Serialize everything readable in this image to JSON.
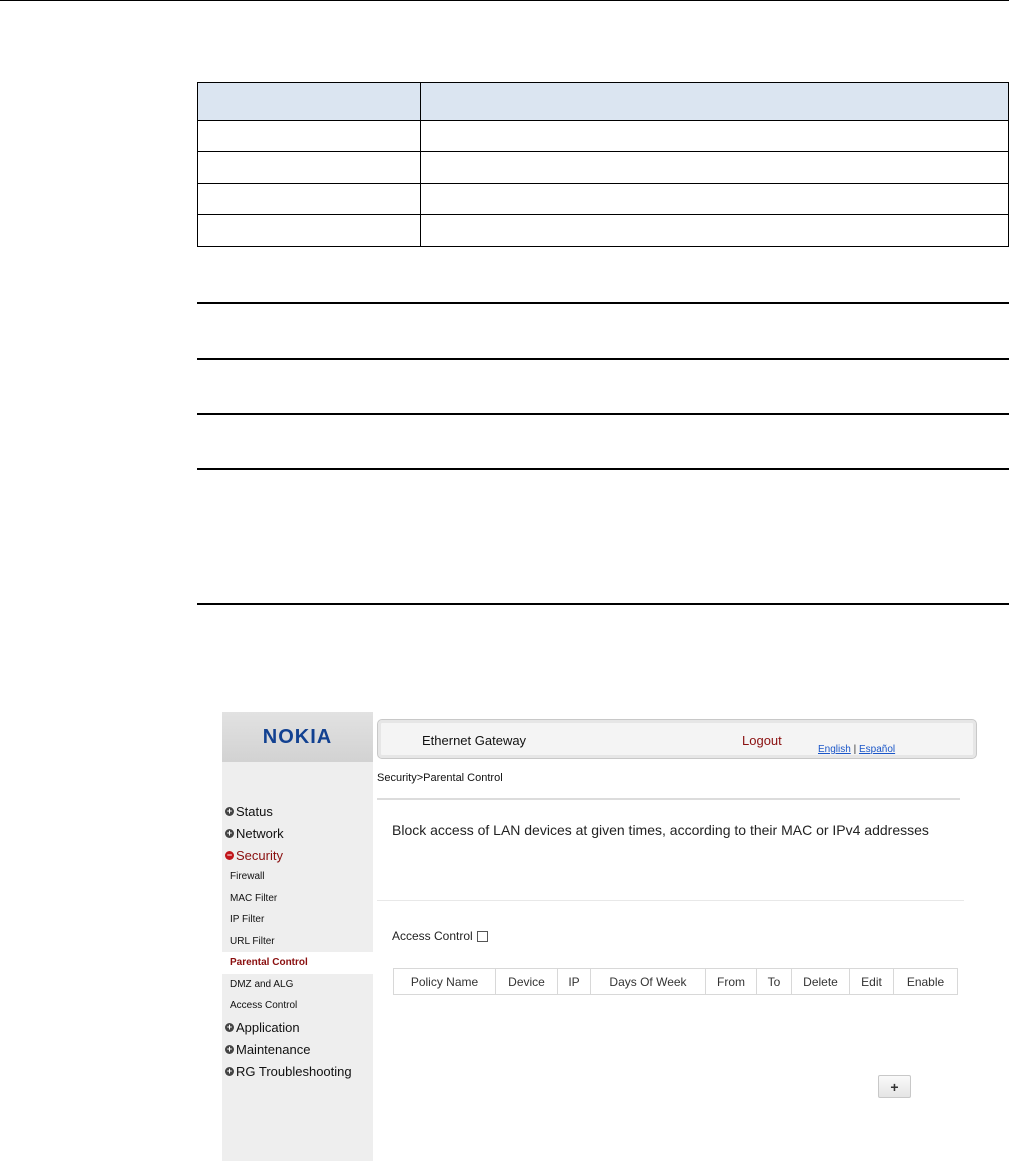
{
  "param_table": {
    "headers": [
      "",
      ""
    ],
    "rows": [
      [
        "",
        ""
      ],
      [
        "",
        ""
      ],
      [
        "",
        ""
      ],
      [
        "",
        ""
      ]
    ]
  },
  "screenshot": {
    "logo": "NOKIA",
    "header": {
      "title": "Ethernet Gateway",
      "logout": "Logout",
      "lang_english": "English",
      "lang_sep": " | ",
      "lang_spanish": "Español"
    },
    "breadcrumb": "Security>Parental Control",
    "description": "Block access of LAN devices at given times, according to their MAC or IPv4 addresses",
    "access_control_label": "Access Control",
    "nav": {
      "status": "Status",
      "network": "Network",
      "security": "Security",
      "security_items": [
        "Firewall",
        "MAC Filter",
        "IP Filter",
        "URL Filter",
        "Parental Control",
        "DMZ and ALG",
        "Access Control"
      ],
      "application": "Application",
      "maintenance": "Maintenance",
      "rg_troubleshooting": "RG Troubleshooting"
    },
    "policy_columns": [
      "Policy Name",
      "Device",
      "IP",
      "Days Of Week",
      "From",
      "To",
      "Delete",
      "Edit",
      "Enable"
    ],
    "add_button": "+"
  }
}
